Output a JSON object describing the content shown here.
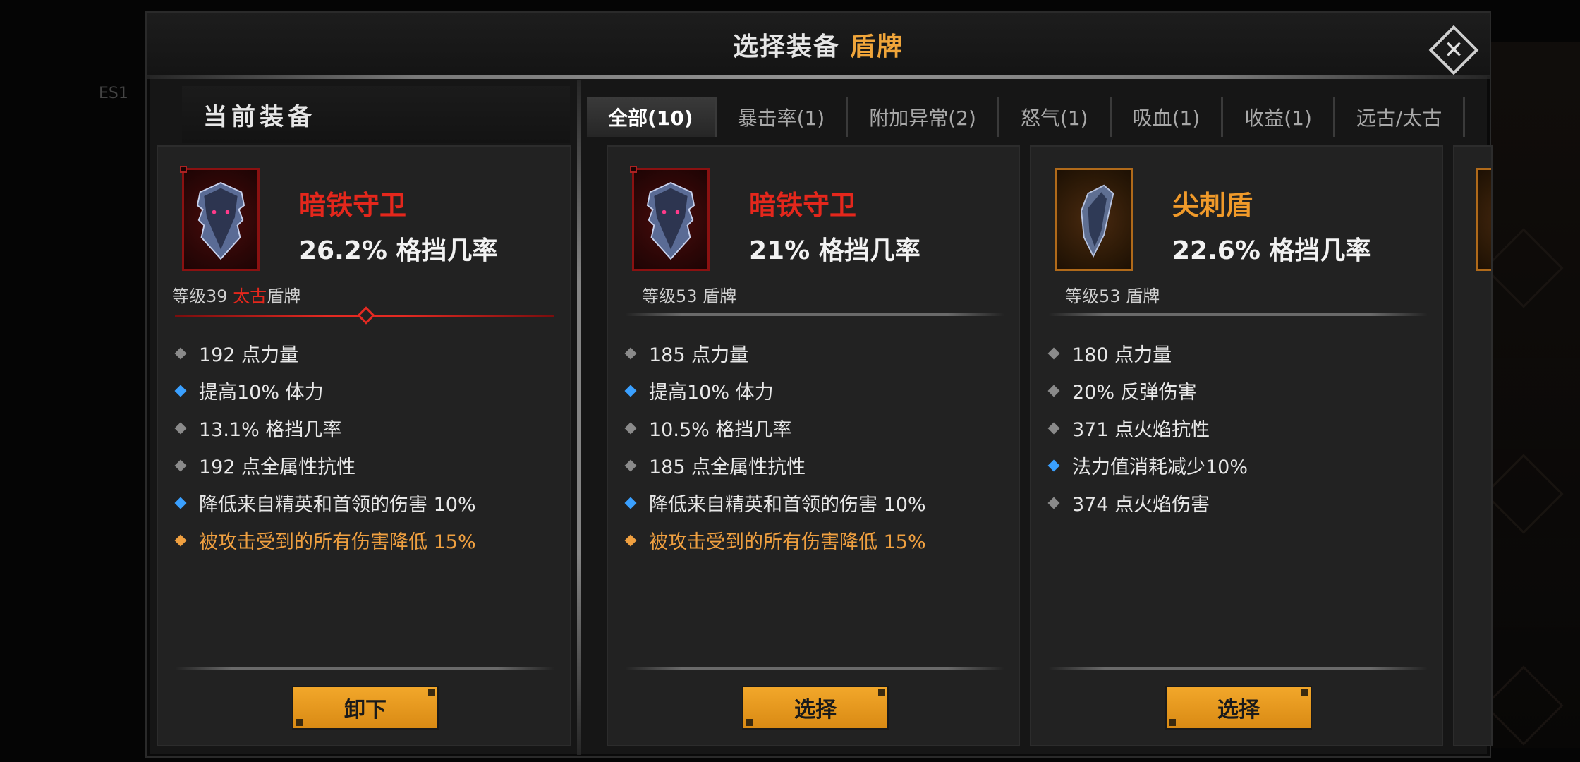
{
  "dialog": {
    "title": "选择装备",
    "category": "盾牌",
    "close_label": "✕"
  },
  "background": {
    "left_label": "ES1"
  },
  "current_panel": {
    "title": "当前装备"
  },
  "tabs": [
    {
      "label": "全部(10)",
      "active": true
    },
    {
      "label": "暴击率(1)",
      "active": false
    },
    {
      "label": "附加异常(2)",
      "active": false
    },
    {
      "label": "怒气(1)",
      "active": false
    },
    {
      "label": "吸血(1)",
      "active": false
    },
    {
      "label": "收益(1)",
      "active": false
    },
    {
      "label": "远古/太古",
      "active": false
    }
  ],
  "current_item": {
    "name": "暗铁守卫",
    "name_color": "#e4271c",
    "main_stat": "26.2% 格挡几率",
    "level_prefix": "等级39",
    "rarity": "太古",
    "type": "盾牌",
    "icon": "dark-shield-icon",
    "attributes": [
      {
        "text": "192 点力量",
        "kind": "primary"
      },
      {
        "text": "提高10% 体力",
        "kind": "secondary"
      },
      {
        "text": "13.1% 格挡几率",
        "kind": "primary"
      },
      {
        "text": "192 点全属性抗性",
        "kind": "primary"
      },
      {
        "text": "降低来自精英和首领的伤害 10%",
        "kind": "secondary"
      },
      {
        "text": "被攻击受到的所有伤害降低 15%",
        "kind": "legendary"
      }
    ],
    "button_label": "卸下"
  },
  "candidates": [
    {
      "name": "暗铁守卫",
      "name_color": "#e4271c",
      "main_stat": "21% 格挡几率",
      "level_line": "等级53 盾牌",
      "icon": "dark-shield-icon",
      "attributes": [
        {
          "text": "185 点力量",
          "kind": "primary"
        },
        {
          "text": "提高10% 体力",
          "kind": "secondary"
        },
        {
          "text": "10.5% 格挡几率",
          "kind": "primary"
        },
        {
          "text": "185 点全属性抗性",
          "kind": "primary"
        },
        {
          "text": "降低来自精英和首领的伤害 10%",
          "kind": "secondary"
        },
        {
          "text": "被攻击受到的所有伤害降低 15%",
          "kind": "legendary"
        }
      ],
      "button_label": "选择"
    },
    {
      "name": "尖刺盾",
      "name_color": "#f09a2a",
      "main_stat": "22.6% 格挡几率",
      "level_line": "等级53 盾牌",
      "icon": "spike-shield-icon",
      "attributes": [
        {
          "text": "180 点力量",
          "kind": "primary"
        },
        {
          "text": "20% 反弹伤害",
          "kind": "primary"
        },
        {
          "text": "371 点火焰抗性",
          "kind": "primary"
        },
        {
          "text": "法力值消耗减少10%",
          "kind": "secondary"
        },
        {
          "text": "374 点火焰伤害",
          "kind": "primary"
        }
      ],
      "button_label": "选择"
    }
  ],
  "colors": {
    "accent": "#f0a53a",
    "legendary": "#f0a040",
    "ancient_red": "#e4271c",
    "secondary_blue": "#3aa0ff",
    "button": "#f2a72a"
  }
}
